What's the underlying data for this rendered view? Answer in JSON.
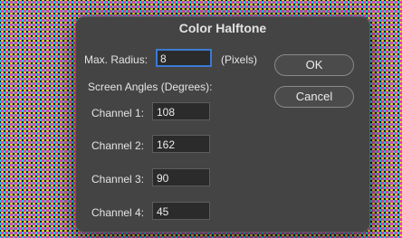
{
  "dialog": {
    "title": "Color Halftone",
    "max_radius": {
      "label": "Max. Radius:",
      "value": "8",
      "unit": "(Pixels)"
    },
    "screen_angles_label": "Screen Angles (Degrees):",
    "channels": [
      {
        "label": "Channel 1:",
        "value": "108"
      },
      {
        "label": "Channel 2:",
        "value": "162"
      },
      {
        "label": "Channel 3:",
        "value": "90"
      },
      {
        "label": "Channel 4:",
        "value": "45"
      }
    ],
    "ok_label": "OK",
    "cancel_label": "Cancel"
  }
}
